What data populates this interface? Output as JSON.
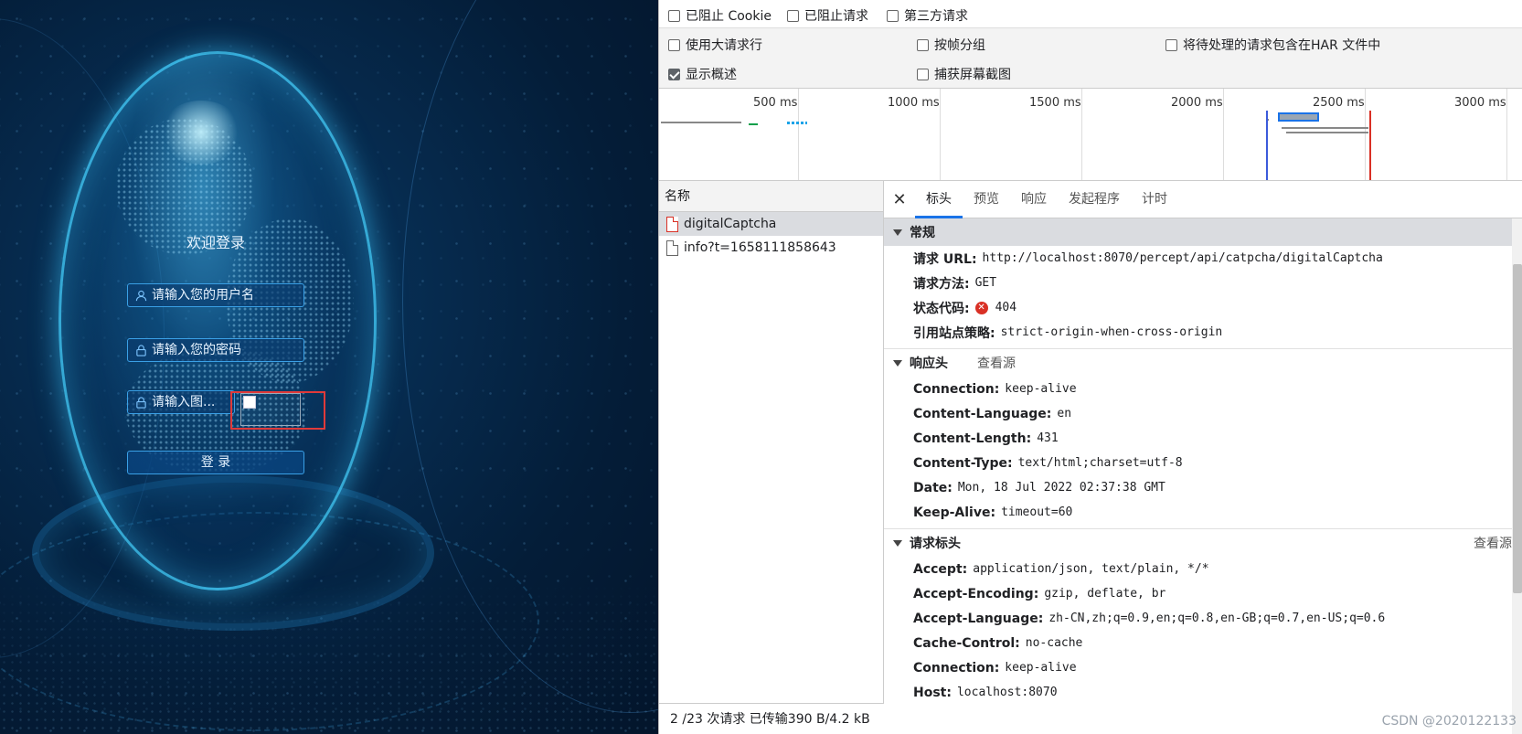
{
  "login": {
    "title": "欢迎登录",
    "username_placeholder": "请输入您的用户名",
    "password_placeholder": "请输入您的密码",
    "captcha_placeholder": "请输入图...",
    "login_button": "登 录"
  },
  "devtools": {
    "filters": {
      "blocked_cookie": "已阻止 Cookie",
      "blocked_requests": "已阻止请求",
      "third_party": "第三方请求"
    },
    "settings": {
      "large_rows": "使用大请求行",
      "group_by_frame": "按帧分组",
      "har_pending": "将待处理的请求包含在HAR 文件中",
      "show_overview": "显示概述",
      "screenshots": "捕获屏幕截图"
    },
    "overview_ticks": [
      "500 ms",
      "1000 ms",
      "1500 ms",
      "2000 ms",
      "2500 ms",
      "3000 ms"
    ],
    "name_header": "名称",
    "requests": [
      {
        "name": "digitalCaptcha"
      },
      {
        "name": "info?t=1658111858643"
      }
    ],
    "status_bar": "2 /23 次请求  已传输390 B/4.2 kB  ",
    "tabs": [
      "标头",
      "预览",
      "响应",
      "发起程序",
      "计时"
    ],
    "general": {
      "title": "常规",
      "url_key": "请求 URL:",
      "url_val": "http://localhost:8070/percept/api/catpcha/digitalCaptcha",
      "method_key": "请求方法:",
      "method_val": "GET",
      "status_key": "状态代码:",
      "status_val": "404",
      "referrer_key": "引用站点策略:",
      "referrer_val": "strict-origin-when-cross-origin"
    },
    "response_headers": {
      "title": "响应头",
      "view_source": "查看源",
      "items": [
        {
          "k": "Connection:",
          "v": "keep-alive"
        },
        {
          "k": "Content-Language:",
          "v": "en"
        },
        {
          "k": "Content-Length:",
          "v": "431"
        },
        {
          "k": "Content-Type:",
          "v": "text/html;charset=utf-8"
        },
        {
          "k": "Date:",
          "v": "Mon, 18 Jul 2022 02:37:38 GMT"
        },
        {
          "k": "Keep-Alive:",
          "v": "timeout=60"
        }
      ]
    },
    "request_headers": {
      "title": "请求标头",
      "view_source": "查看源",
      "items": [
        {
          "k": "Accept:",
          "v": "application/json, text/plain, */*"
        },
        {
          "k": "Accept-Encoding:",
          "v": "gzip, deflate, br"
        },
        {
          "k": "Accept-Language:",
          "v": "zh-CN,zh;q=0.9,en;q=0.8,en-GB;q=0.7,en-US;q=0.6"
        },
        {
          "k": "Cache-Control:",
          "v": "no-cache"
        },
        {
          "k": "Connection:",
          "v": "keep-alive"
        },
        {
          "k": "Host:",
          "v": "localhost:8070"
        }
      ]
    },
    "watermark": "CSDN @2020122133"
  },
  "colors": {
    "accent": "#1a73e8",
    "error": "#d93025",
    "highlight": "#e03a3a"
  }
}
